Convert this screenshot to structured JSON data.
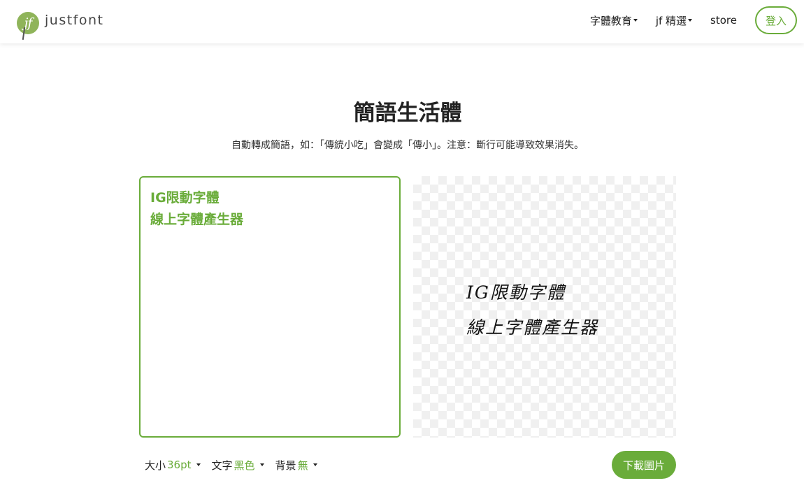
{
  "header": {
    "logo_mark": "jf",
    "logo_text": "justfont",
    "nav": [
      {
        "label": "字體教育",
        "dropdown": true
      },
      {
        "label": "jf 精選",
        "dropdown": true
      },
      {
        "label": "store",
        "dropdown": false
      }
    ],
    "login_label": "登入"
  },
  "main": {
    "title": "簡語生活體",
    "subtitle": "自動轉成簡語，如：「傳統小吃」會變成「傳小」。注意：斷行可能導致效果消失。",
    "editor_text": "IG限動字體\n線上字體產生器",
    "preview_text": "IG限動字體\n線上字體產生器"
  },
  "controls": {
    "size_label": "大小",
    "size_value": "36pt",
    "text_color_label": "文字",
    "text_color_value": "黑色",
    "background_label": "背景",
    "background_value": "無",
    "download_label": "下載圖片"
  },
  "colors": {
    "accent": "#6aac3a",
    "logo": "#8fb45a",
    "text": "#222222",
    "checker": "#f0f0f0"
  }
}
